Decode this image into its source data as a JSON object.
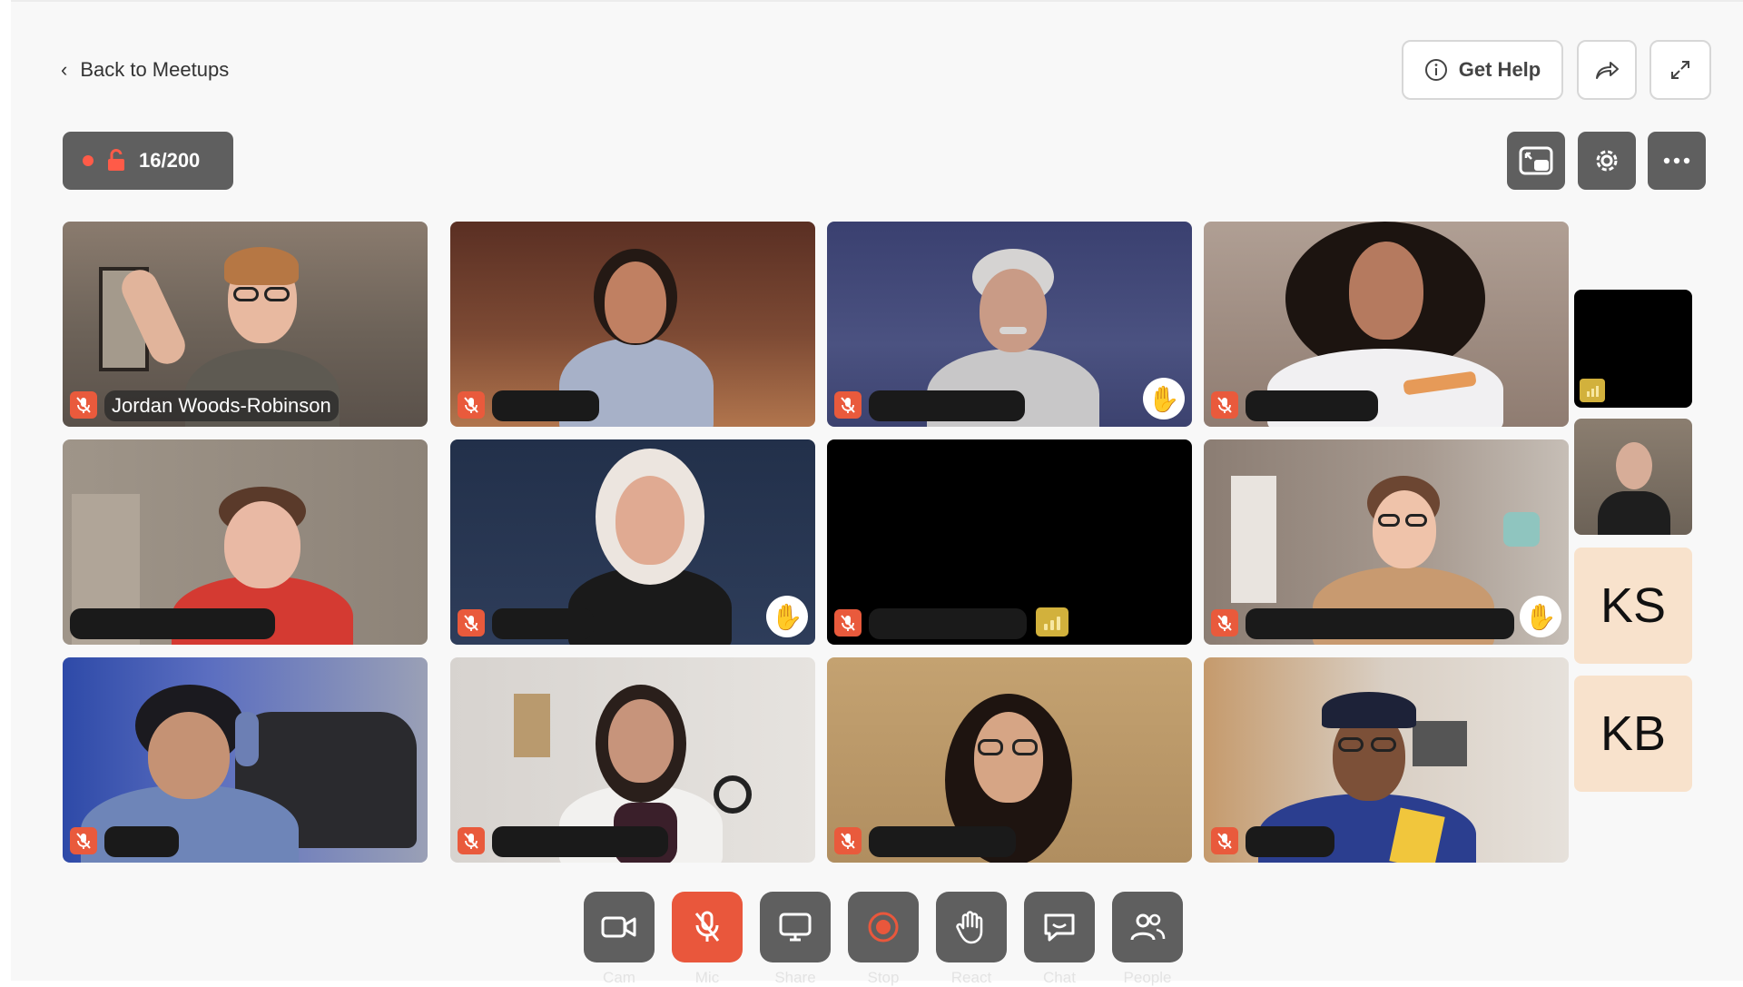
{
  "header": {
    "back_label": "Back to Meetups",
    "get_help_label": "Get Help",
    "share_icon": "share-arrow-icon",
    "fullscreen_icon": "expand-icon"
  },
  "room": {
    "capacity_label": "16/200",
    "recording_color": "#ff5b48",
    "lock_icon": "unlocked-padlock-icon"
  },
  "toolbar": {
    "items": [
      {
        "icon": "picture-in-picture-icon"
      },
      {
        "icon": "gear-icon"
      },
      {
        "icon": "more-icon"
      }
    ]
  },
  "participants": [
    {
      "name": "Jordan Woods-Robinson",
      "muted": true,
      "hand_raised": false
    },
    {
      "name": "",
      "muted": true,
      "hand_raised": false
    },
    {
      "name": "",
      "muted": true,
      "hand_raised": true
    },
    {
      "name": "",
      "muted": true,
      "hand_raised": false
    },
    {
      "name": "",
      "muted": false,
      "hand_raised": false
    },
    {
      "name": "",
      "muted": true,
      "hand_raised": true
    },
    {
      "name": "",
      "muted": true,
      "hand_raised": false,
      "audio_level": true,
      "camera_off": true
    },
    {
      "name": "",
      "muted": true,
      "hand_raised": true
    },
    {
      "name": "",
      "muted": true,
      "hand_raised": false
    },
    {
      "name": "",
      "muted": true,
      "hand_raised": false
    },
    {
      "name": "",
      "muted": true,
      "hand_raised": false
    },
    {
      "name": "",
      "muted": true,
      "hand_raised": false
    }
  ],
  "sidebar": {
    "initials": [
      "KS",
      "KB"
    ]
  },
  "controls": [
    {
      "label": "Cam",
      "icon": "camera-icon"
    },
    {
      "label": "Mic",
      "icon": "mic-off-icon",
      "active": true
    },
    {
      "label": "Share",
      "icon": "screen-share-icon"
    },
    {
      "label": "Stop",
      "icon": "record-stop-icon"
    },
    {
      "label": "React",
      "icon": "hand-icon"
    },
    {
      "label": "Chat",
      "icon": "chat-icon"
    },
    {
      "label": "People",
      "icon": "people-icon"
    }
  ],
  "colors": {
    "accent_red": "#e9573c",
    "control_gray": "#5f5f5f",
    "initials_bg": "#f8e2cc",
    "audio_level_yellow": "#d2b13c"
  }
}
